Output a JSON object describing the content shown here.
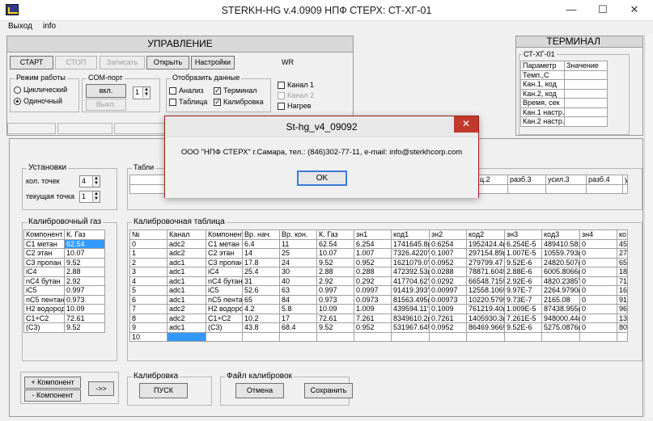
{
  "window": {
    "title": "STERKH-HG  v.4.0909     НПФ СТЕРХ: СТ-ХГ-01",
    "minimize": "—",
    "maximize": "☐",
    "close": "✕"
  },
  "menu": [
    "Выход",
    "info"
  ],
  "control": {
    "title": "УПРАВЛЕНИЕ",
    "buttons": {
      "start": "СТАРТ",
      "stop": "СТОП",
      "write": "Записать",
      "open": "Открыть",
      "settings": "Настройки"
    },
    "wr": "WR",
    "mode": {
      "label": "Режим работы",
      "cyclic": "Циклический",
      "single": "Одиночный"
    },
    "com": {
      "label": "COM-порт",
      "on": "вкл.",
      "off": "Выкл.",
      "port": "1"
    },
    "display": {
      "label": "Отобразить данные",
      "analysis": "Анализ",
      "terminal": "Терминал",
      "table": "Таблица",
      "calibration": "Калибровка"
    },
    "channels": {
      "ch1": "Канал 1",
      "ch2": "Канал 2",
      "heat": "Нагрев"
    }
  },
  "terminal": {
    "title": "ТЕРМИНАЛ",
    "device": "СТ-ХГ-01",
    "headers": [
      "Параметр",
      "Значение"
    ],
    "params": [
      "Темп.,С",
      "Кан.1, код",
      "Кан.2, код",
      "Время, сек",
      "Кан.1 настр.",
      "Кан.2 настр."
    ]
  },
  "settings_box": {
    "label": "Установки",
    "points_label": "кол. точек",
    "points": "4",
    "current_label": "текущая точка",
    "current": "1"
  },
  "table_label": "Табли",
  "top_table_headers": [
    "ц.2",
    "разб.3",
    "усил.3",
    "разб.4",
    "ус"
  ],
  "gas_box": {
    "label": "Калибровочный газ",
    "headers": [
      "Компонент",
      "К. Газ"
    ],
    "rows": [
      [
        "C1 метан",
        "62.54"
      ],
      [
        "C2 этан",
        "10.07"
      ],
      [
        "C3 пропан",
        "9.52"
      ],
      [
        "iC4",
        "2.88"
      ],
      [
        "nC4 бутан",
        "2.92"
      ],
      [
        "iC5",
        "0.997"
      ],
      [
        "nC5 пентан",
        "0.973"
      ],
      [
        "H2 водород",
        "10.09"
      ],
      [
        "C1+C2",
        "72.61"
      ],
      [
        "(C3)",
        "9.52"
      ]
    ]
  },
  "calib_table": {
    "label": "Калибровочная таблица",
    "headers": [
      "№",
      "Канал",
      "Компонент",
      "Вр. нач.",
      "Вр. кон.",
      "К. Газ",
      "зн1",
      "код1",
      "зн2",
      "код2",
      "зн3",
      "код3",
      "зн4",
      "ко"
    ],
    "rows": [
      [
        "0",
        "adc2",
        "C1 метан",
        "6.4",
        "11",
        "62.54",
        "6.254",
        "1741645.8(",
        "0.6254",
        "1952424.4(",
        "6.254E-5",
        "489410.58:",
        "0",
        "45"
      ],
      [
        "1",
        "adc2",
        "C2 этан",
        "14",
        "25",
        "10.07",
        "1.007",
        "7326.4220'",
        "0.1007",
        "297154.89(",
        "1.007E-5",
        "10559.793(",
        "0",
        "27"
      ],
      [
        "2",
        "adc1",
        "C3 пропан",
        "17.8",
        "24",
        "9.52",
        "0.952",
        "1621079.0'",
        "0.0952",
        "279799.47",
        "9.52E-6",
        "24820.507(",
        "0",
        "65"
      ],
      [
        "3",
        "adc1",
        "iC4",
        "25.4",
        "30",
        "2.88",
        "0.288",
        "472392.53(",
        "0.0288",
        "78871.604!",
        "2.88E-6",
        "6005.8066(",
        "0",
        "18"
      ],
      [
        "4",
        "adc1",
        "nC4 бутан",
        "31",
        "40",
        "2.92",
        "0.292",
        "417704.62'",
        "0.0292",
        "66548.715!",
        "2.92E-6",
        "4820.2385'",
        "0",
        "71"
      ],
      [
        "5",
        "adc1",
        "iC5",
        "52.6",
        "63",
        "0.997",
        "0.0997",
        "91419.393'",
        "0.00997",
        "12558.106!",
        "9.97E-7",
        "2264.9790(",
        "0",
        "16"
      ],
      [
        "6",
        "adc1",
        "nC5 пента",
        "65",
        "84",
        "0.973",
        "0.0973",
        "81563.495(",
        "0.00973",
        "10220.579!",
        "9.73E-7",
        "2165.08",
        "0",
        "91"
      ],
      [
        "7",
        "adc2",
        "H2 водоро",
        "4.2",
        "5.8",
        "10.09",
        "1.009",
        "439594.11'",
        "0.1009",
        "761219.40(",
        "1.009E-5",
        "87438.955(",
        "0",
        "96"
      ],
      [
        "8",
        "adc2",
        "C1+C2",
        "10.2",
        "17",
        "72.61",
        "7.261",
        "8349610.2(",
        "0.7261",
        "1405930.3(",
        "7.261E-5",
        "948000.44(",
        "0",
        "13"
      ],
      [
        "9",
        "adc1",
        "(C3)",
        "43.8",
        "68.4",
        "9.52",
        "0.952",
        "531967.64!",
        "0.0952",
        "86469.966!",
        "9.52E-6",
        "5275.0876(",
        "0",
        "80"
      ],
      [
        "10",
        "",
        "",
        "",
        "",
        "",
        "",
        "",
        "",
        "",
        "",
        "",
        "",
        ""
      ]
    ]
  },
  "bottom": {
    "add": "+ Компонент",
    "remove": "- Компонент",
    "next": "->>",
    "calib_label": "Калибровка",
    "start_btn": "ПУСК",
    "file_label": "Файл калибровок",
    "cancel": "Отмена",
    "save": "Сохранить"
  },
  "dialog": {
    "title": "St-hg_v4_09092",
    "close": "✕",
    "message": "ООО \"НПФ СТЕРХ\" г.Самара, тел.: (846)302-77-11, e-mail: info@sterkhcorp.com",
    "ok": "OK"
  }
}
